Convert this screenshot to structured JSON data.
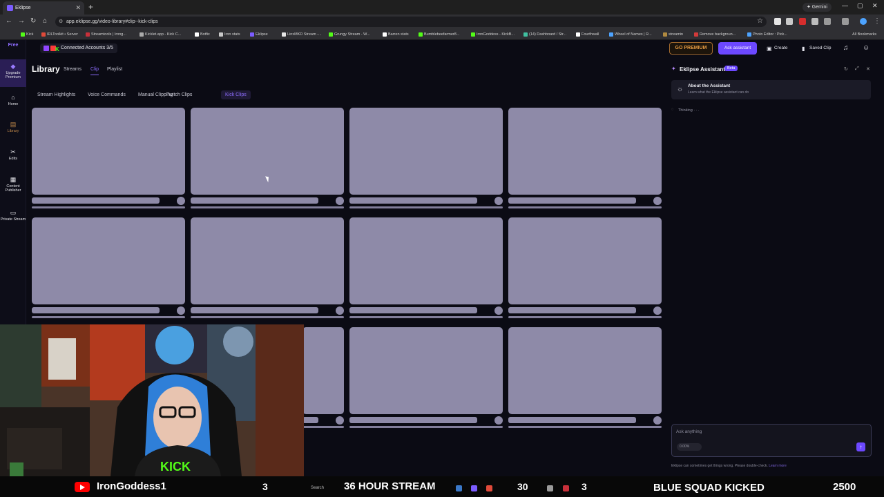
{
  "browser": {
    "tab_title": "Eklipse",
    "new_tab": "+",
    "gemini": "✦ Gemini",
    "url": "app.eklipse.gg/video-library#clip--kick-clips",
    "bookmarks": [
      "Kick",
      "IRLToolkit • Server",
      "Streamtools | Irong...",
      "Kicklet.app - Kick C...",
      "Botfix",
      "Iron stats",
      "Eklipse",
      "LinxMKD Stream -...",
      "Grungy Stream - W...",
      "Barren stats",
      "Bumblebeefarmer8...",
      "IronGoddess - KickB...",
      "(14) Dashboard / Str...",
      "Fourthwall",
      "Wheel of Names | R...",
      "streamin",
      "Remove backgroun...",
      "Photo Editor : Pick..."
    ],
    "all_bookmarks": "All Bookmarks"
  },
  "sidebar": {
    "free_label": "Free",
    "upgrade": "Upgrade Premium",
    "items": [
      {
        "label": "Home",
        "icon": "home-icon"
      },
      {
        "label": "Library",
        "icon": "library-icon"
      },
      {
        "label": "Edits",
        "icon": "scissors-icon"
      },
      {
        "label": "Content Publisher",
        "icon": "calendar-icon"
      },
      {
        "label": "Private Stream",
        "icon": "video-icon"
      }
    ]
  },
  "header": {
    "connected": "Connected Accounts 3/5",
    "go_premium": "GO PREMIUM",
    "ask_assistant": "Ask assistant",
    "create": "Create",
    "saved_clip": "Saved Clip"
  },
  "library": {
    "title": "Library",
    "tabs": [
      "Streams",
      "Clip",
      "Playlist"
    ],
    "active_tab": "Clip",
    "subtabs": [
      "Stream Highlights",
      "Voice Commands",
      "Manual Clipping",
      "Twitch Clips",
      "Kick Clips"
    ],
    "active_subtab": "Kick Clips"
  },
  "assistant": {
    "title": "Eklipse Assistant",
    "beta": "Beta",
    "about_title": "About the Assistant",
    "about_sub": "Learn what the Eklipse assistant can do",
    "thinking": "Thinking · · .",
    "input_placeholder": "Ask anything",
    "usage": "0.00%",
    "disclaimer": "Eklipse can sometimes get things wrong. Please double-check.",
    "learn_more": "Learn more"
  },
  "stream_overlay": {
    "channel": "IronGoddess1",
    "title": "36 HOUR STREAM",
    "squad": "BLUE SQUAD KICKED",
    "count": "2500",
    "num_a": "3",
    "num_b": "30",
    "num_c": "3",
    "search": "Search"
  },
  "colors": {
    "accent": "#6c48ff",
    "premium": "#e59a41",
    "skeleton": "#8e8aa8",
    "background": "#0b0b14"
  }
}
